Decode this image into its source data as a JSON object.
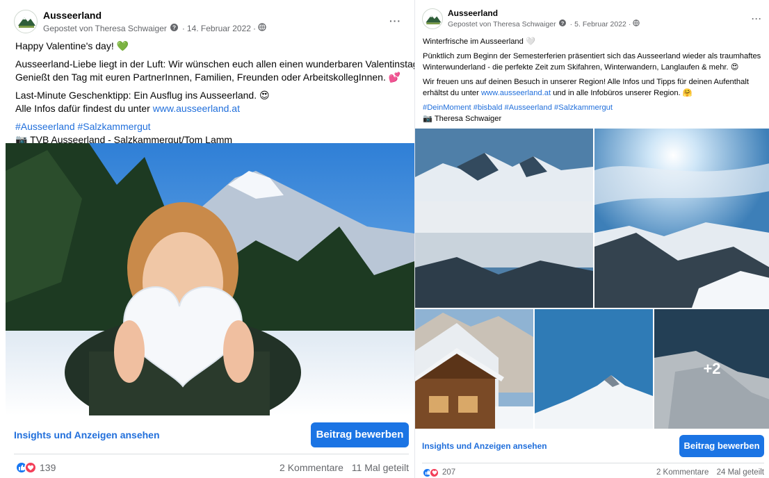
{
  "colors": {
    "link": "#216fdb",
    "button": "#1b74e4",
    "meta": "#65676b",
    "like": "#1877f2",
    "love": "#f33e58"
  },
  "posts": [
    {
      "page_name": "Ausseerland",
      "posted_by": "Gepostet von Theresa Schwaiger",
      "date": "14. Februar 2022",
      "more_label": "···",
      "caption": {
        "line1": "Happy Valentine's day! 💚",
        "line2": "Ausseerland-Liebe liegt in der Luft: Wir wünschen euch allen einen wunderbaren Valentinstag.",
        "line3": "Genießt den Tag mit euren PartnerInnen, Familien, Freunden oder ArbeitskollegInnen. 💕",
        "line4": "Last-Minute Geschenktipp: Ein Ausflug ins Ausseerland. 😍",
        "line5_prefix": "Alle Infos dafür findest du unter ",
        "line5_link": "www.ausseerland.at",
        "hashtags": "#Ausseerland #Salzkammergut",
        "credit": "📷 TVB Ausseerland - Salzkammergut/Tom Lamm"
      },
      "insights_label": "Insights und Anzeigen ansehen",
      "boost_label": "Beitrag bewerben",
      "reactions_count": "139",
      "comments": "2 Kommentare",
      "shares": "11 Mal geteilt"
    },
    {
      "page_name": "Ausseerland",
      "posted_by": "Gepostet von Theresa Schwaiger",
      "date": "5. Februar 2022",
      "more_label": "···",
      "caption": {
        "line1": "Winterfrische im Ausseerland 🤍",
        "line2": "Pünktlich zum Beginn der Semesterferien präsentiert sich das Ausseerland wieder als traumhaftes",
        "line3": "Winterwunderland - die perfekte Zeit zum Skifahren, Winterwandern, Langlaufen & mehr. 😍",
        "line4": "Wir freuen uns auf deinen Besuch in unserer Region! Alle Infos und Tipps für deinen Aufenthalt",
        "line5_prefix": "erhältst du unter ",
        "line5_link": "www.ausseerland.at",
        "line5_suffix": " und in alle Infobüros unserer Region. 🤗",
        "hashtags": "#DeinMoment #bisbald #Ausseerland #Salzkammergut",
        "credit": "📷 Theresa Schwaiger"
      },
      "more_photos": "+2",
      "insights_label": "Insights und Anzeigen ansehen",
      "boost_label": "Beitrag bewerben",
      "reactions_count": "207",
      "comments": "2 Kommentare",
      "shares": "24 Mal geteilt"
    }
  ]
}
